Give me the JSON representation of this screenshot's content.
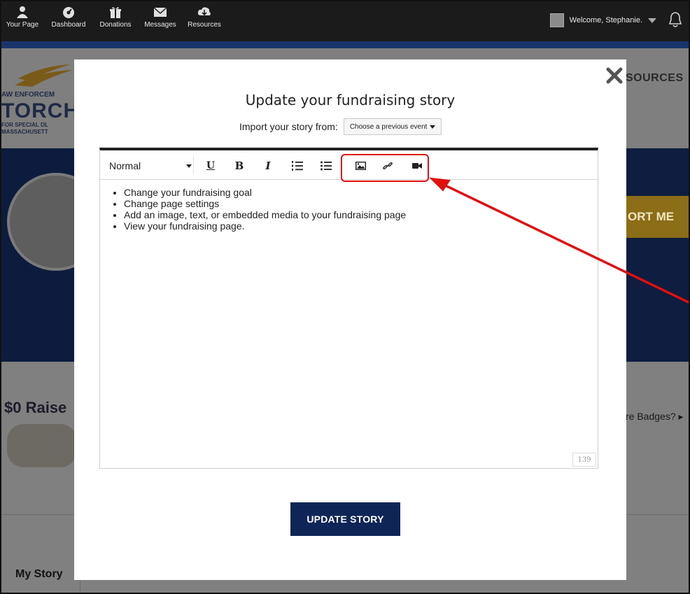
{
  "nav": {
    "items": [
      {
        "label": "Your Page",
        "icon": "user-icon"
      },
      {
        "label": "Dashboard",
        "icon": "dashboard-icon"
      },
      {
        "label": "Donations",
        "icon": "gift-icon"
      },
      {
        "label": "Messages",
        "icon": "envelope-icon"
      },
      {
        "label": "Resources",
        "icon": "cloud-download-icon"
      }
    ],
    "welcome": "Welcome, Stephanie."
  },
  "background": {
    "logo_line1": "AW ENFORCEM",
    "logo_line2": "TORCH",
    "logo_line3": "FOR SPECIAL OL",
    "logo_line4": "MASSACHUSETT",
    "resources_text": "SOURCES",
    "support_text": "ORT ME",
    "raised_text": "$0 Raise",
    "badges_text": "re Badges? ▸",
    "mystory_text": "My Story"
  },
  "modal": {
    "title": "Update your fundraising story",
    "import_label": "Import your story from:",
    "import_select": "Choose a previous event",
    "toolbar": {
      "format_value": "Normal",
      "underline": "U",
      "bold": "B",
      "italic": "I"
    },
    "content": [
      "Change your fundraising goal",
      "Change page settings",
      "Add an image, text, or embedded media to your fundraising page",
      "View your fundraising page."
    ],
    "char_counter": "139",
    "submit_label": "UPDATE STORY"
  },
  "colors": {
    "nav_bg": "#1b1b1b",
    "brand_navy": "#0f2557",
    "annotation_red": "#e01010"
  }
}
